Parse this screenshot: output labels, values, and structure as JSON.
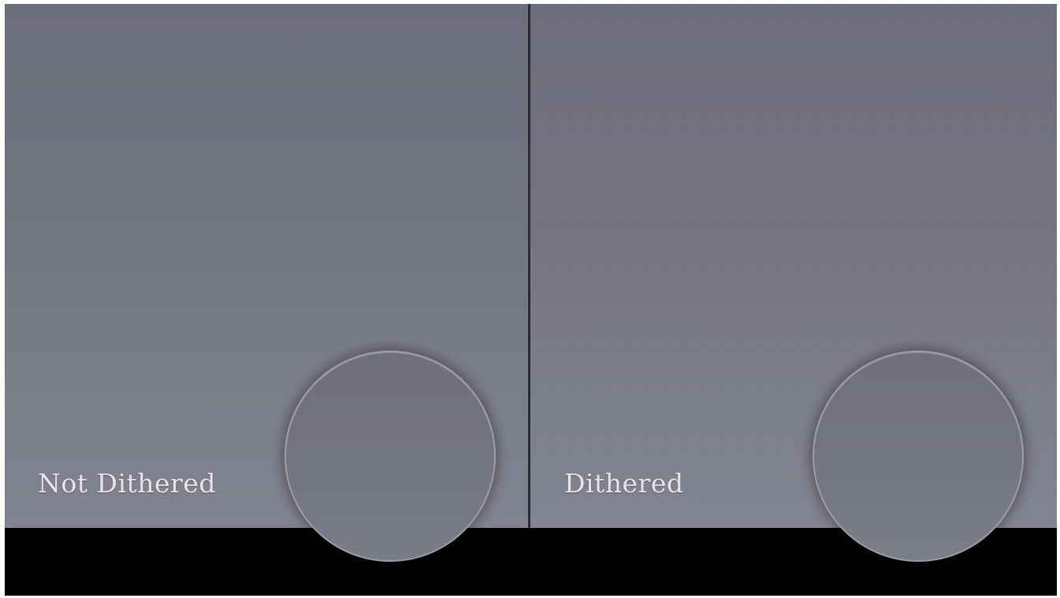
{
  "panels": {
    "left": {
      "label": "Not Dithered"
    },
    "right": {
      "label": "Dithered"
    }
  },
  "colors": {
    "panel_top": "#6d6e7b",
    "panel_bottom": "#818390",
    "divider": "#2a2b33",
    "bottom_bar": "#000000",
    "label_text": "#e4e5ea",
    "circle_border": "#9b9ca9"
  }
}
